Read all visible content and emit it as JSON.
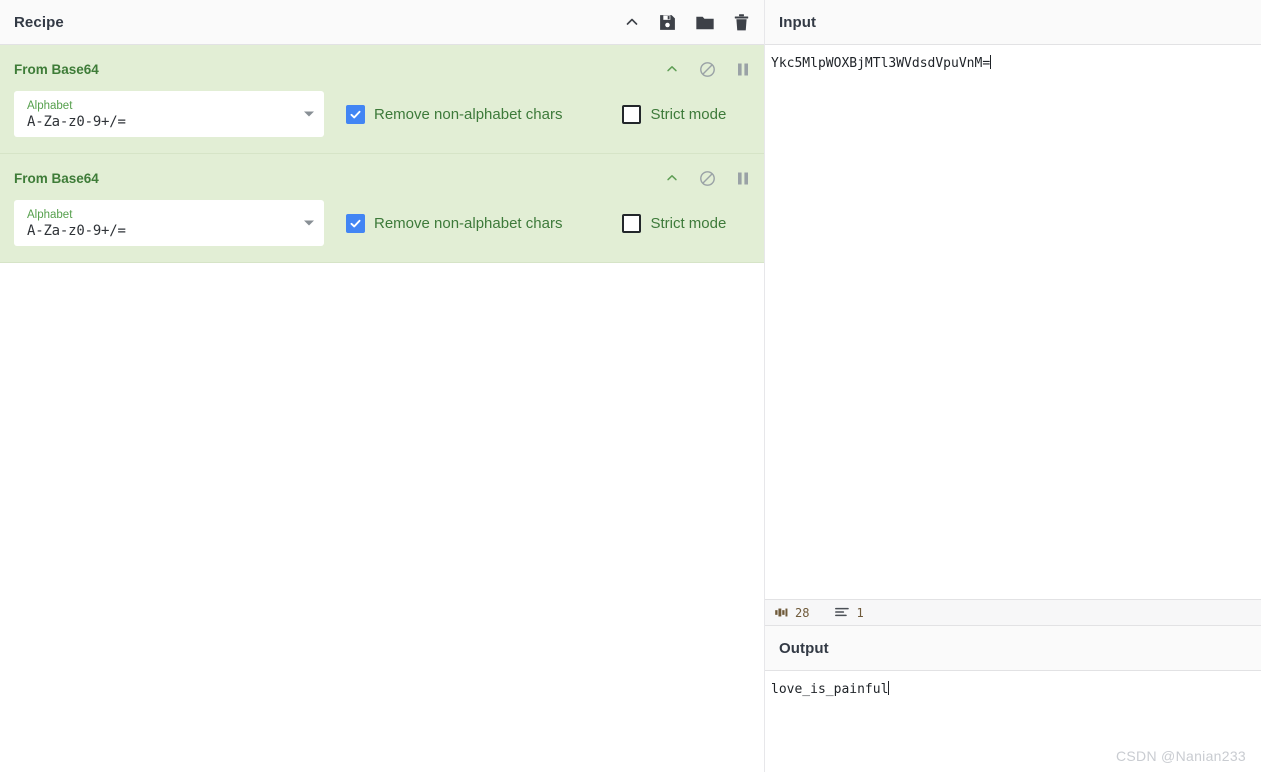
{
  "recipe": {
    "title": "Recipe",
    "header_icons": [
      {
        "name": "collapse-icon",
        "glyph": "chevron-up"
      },
      {
        "name": "save-recipe-icon",
        "glyph": "save"
      },
      {
        "name": "load-recipe-icon",
        "glyph": "folder"
      },
      {
        "name": "clear-recipe-icon",
        "glyph": "trash"
      }
    ],
    "operations": [
      {
        "title": "From Base64",
        "arg_label": "Alphabet",
        "arg_value": "A-Za-z0-9+/=",
        "checkbox_remove_label": "Remove non-alphabet chars",
        "checkbox_remove_checked": true,
        "checkbox_strict_label": "Strict mode",
        "checkbox_strict_checked": false,
        "icons": [
          {
            "name": "op-collapse-icon",
            "glyph": "chevron-up"
          },
          {
            "name": "op-disable-icon",
            "glyph": "ban"
          },
          {
            "name": "op-breakpoint-icon",
            "glyph": "pause"
          }
        ]
      },
      {
        "title": "From Base64",
        "arg_label": "Alphabet",
        "arg_value": "A-Za-z0-9+/=",
        "checkbox_remove_label": "Remove non-alphabet chars",
        "checkbox_remove_checked": true,
        "checkbox_strict_label": "Strict mode",
        "checkbox_strict_checked": false,
        "icons": [
          {
            "name": "op-collapse-icon",
            "glyph": "chevron-up"
          },
          {
            "name": "op-disable-icon",
            "glyph": "ban"
          },
          {
            "name": "op-breakpoint-icon",
            "glyph": "pause"
          }
        ]
      }
    ]
  },
  "input": {
    "title": "Input",
    "value": "Ykc5MlpWOXBjMTl3WVdsdVpuVnM=",
    "status": {
      "length_label": "length",
      "length_value": "28",
      "lines_label": "lines",
      "lines_value": "1"
    }
  },
  "output": {
    "title": "Output",
    "value": "love_is_painful"
  },
  "watermark": "CSDN @Nanian233",
  "colors": {
    "operation_bg": "#e2eed5",
    "operation_title": "#3e7c38",
    "checkbox_accent": "#4285f4",
    "arg_label": "#56a04d",
    "header_bg": "#fafafa"
  }
}
